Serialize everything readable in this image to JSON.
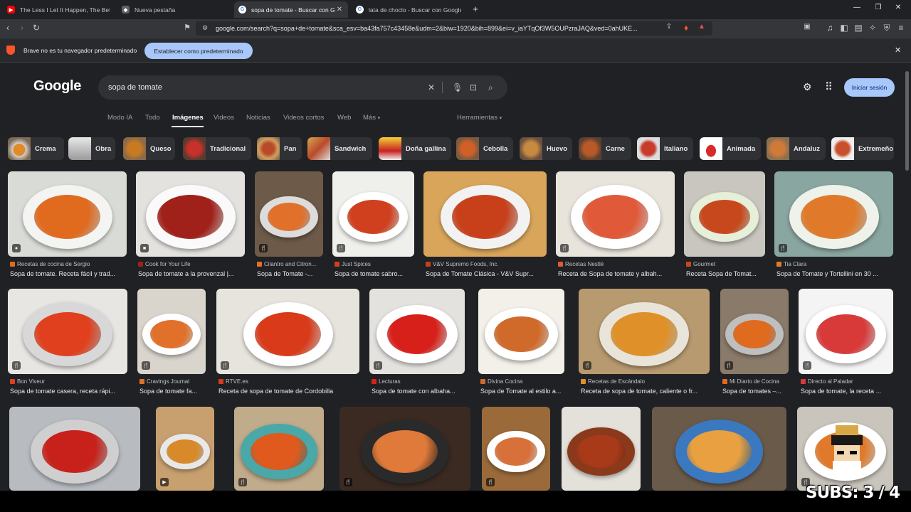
{
  "tabs": [
    {
      "title": "The Less I Let It Happen, The Bett"
    },
    {
      "title": "Nueva pestaña"
    },
    {
      "title": "sopa de tomate - Buscar con Go"
    },
    {
      "title": "lata de choclo - Buscar con Google"
    }
  ],
  "toolbar": {
    "url": "google.com/search?q=sopa+de+tomate&sca_esv=ba43fa757c43458e&udm=2&biw=1920&bih=899&ei=v_iaYTqOf3W5OUPzraJAQ&ved=0ahUKE..."
  },
  "infobar": {
    "message": "Brave no es tu navegador predeterminado",
    "button": "Establecer como predeterminado"
  },
  "google": {
    "logo": "Google",
    "query": "sopa de tomate",
    "signin": "Iniciar sesión",
    "tabs": [
      "Modo IA",
      "Todo",
      "Imágenes",
      "Videos",
      "Noticias",
      "Videos cortos",
      "Web",
      "Más"
    ],
    "tools": "Herramientas"
  },
  "chips": [
    "Crema",
    "Obra",
    "Queso",
    "Tradicional",
    "Pan",
    "Sandwich",
    "Doña gallina",
    "Cebolla",
    "Huevo",
    "Carne",
    "Italiano",
    "Animada",
    "Andaluz",
    "Extremeño"
  ],
  "results": {
    "row1": [
      {
        "source": "Recetas de cocina de Sergio",
        "title": "Sopa de tomate. Receta fácil y trad...",
        "bg": "#d9dcd6",
        "soup": "#e06a1e",
        "rim": "#f4f4f2"
      },
      {
        "source": "Cook for Your Life",
        "title": "Sopa de tomate a la provenzal |...",
        "bg": "#e4e2de",
        "soup": "#a0201a",
        "rim": "#fafafa"
      },
      {
        "source": "Cilantro and Citron...",
        "title": "Sopa de Tomate -...",
        "bg": "#6d5a48",
        "soup": "#e0702a",
        "rim": "#dcdcdc"
      },
      {
        "source": "Just Spices",
        "title": "Sopa de tomate sabro...",
        "bg": "#efefec",
        "soup": "#d0401e",
        "rim": "#ffffff"
      },
      {
        "source": "V&V Supremo Foods, Inc.",
        "title": "Sopa de Tomate Clásica - V&V Supr...",
        "bg": "#d8a55a",
        "soup": "#c8401a",
        "rim": "#f2f2f2"
      },
      {
        "source": "Recetas Nestlé",
        "title": "Receta de Sopa de tomate y albah...",
        "bg": "#e8e4dc",
        "soup": "#e05a3a",
        "rim": "#ffffff"
      },
      {
        "source": "Gourmet",
        "title": "Receta Sopa de Tomat...",
        "bg": "#c9c6bf",
        "soup": "#c8481e",
        "rim": "#e6efd8"
      },
      {
        "source": "Tia Clara",
        "title": "Sopa de Tomate y Tortellini en 30 ...",
        "bg": "#8aa6a0",
        "soup": "#e07a2a",
        "rim": "#eef2ea"
      }
    ],
    "row2": [
      {
        "source": "Bon Viveur",
        "title": "Sopa de tomate casera, receta rápi...",
        "bg": "#e8e6e2",
        "soup": "#e0401e",
        "rim": "#d8d8d8"
      },
      {
        "source": "Cravings Journal",
        "title": "Sopa de tomate fa...",
        "bg": "#d9d4cc",
        "soup": "#e0702a",
        "rim": "#ffffff"
      },
      {
        "source": "RTVE.es",
        "title": "Receta de sopa de tomate de Cordobilla",
        "bg": "#e7e4de",
        "soup": "#d83a1a",
        "rim": "#ffffff"
      },
      {
        "source": "Lecturas",
        "title": "Sopa de tomate con albaha...",
        "bg": "#e4e2de",
        "soup": "#d8201a",
        "rim": "#ffffff"
      },
      {
        "source": "Divina Cocina",
        "title": "Sopa de Tomate al estilo a...",
        "bg": "#f2f0e8",
        "soup": "#d06a2a",
        "rim": "#ffffff"
      },
      {
        "source": "Recetas de Escándalo",
        "title": "Receta de sopa de tomate, caliente o fr...",
        "bg": "#b89a70",
        "soup": "#e09028",
        "rim": "#e9e4da"
      },
      {
        "source": "Mi Diario de Cocina",
        "title": "Sopa de tomates –...",
        "bg": "#8a7a6a",
        "soup": "#e06a1e",
        "rim": "#bfbfbf"
      },
      {
        "source": "Directo al Paladar",
        "title": "Sopa de tomate, la receta ...",
        "bg": "#f4f4f4",
        "soup": "#d83a3a",
        "rim": "#ffffff"
      }
    ],
    "row3": [
      {
        "bg": "#b8bcc0",
        "soup": "#c8201a",
        "rim": "#cfcfcf"
      },
      {
        "bg": "#c8a070",
        "soup": "#d88a2a",
        "rim": "#e8e8e8"
      },
      {
        "bg": "#c0ab8a",
        "soup": "#e05a1e",
        "rim": "#4aa8a8"
      },
      {
        "bg": "#3a2a22",
        "soup": "#e07a3a",
        "rim": "#2a2a2a"
      },
      {
        "bg": "#9a6a3a",
        "soup": "#d8703a",
        "rim": "#ffffff"
      },
      {
        "bg": "#e4e0da",
        "soup": "#a83a1a",
        "rim": "#8a3a1a"
      },
      {
        "bg": "#6a5a4a",
        "soup": "#e8a040",
        "rim": "#3a78c0"
      },
      {
        "bg": "#c9c4bc",
        "soup": "#e07a2a",
        "rim": "#ffffff"
      }
    ]
  },
  "overlay": {
    "subs": "SUBS: 3 / 4"
  }
}
